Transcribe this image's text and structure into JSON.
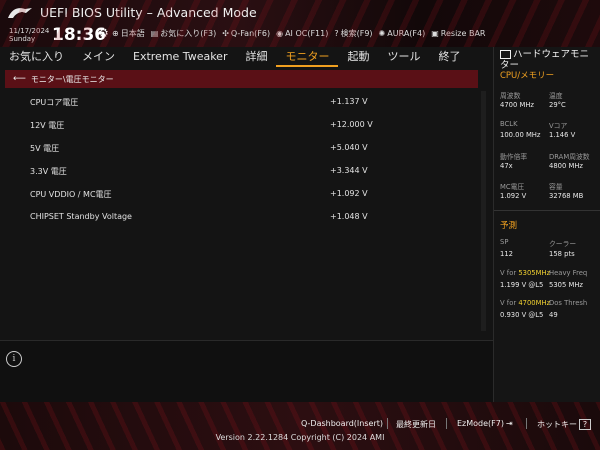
{
  "header": {
    "title": "UEFI BIOS Utility – Advanced Mode",
    "date": "11/17/2024",
    "day": "Sunday",
    "time": "18:36",
    "tools": [
      {
        "icon": "globe-icon",
        "label": "日本語"
      },
      {
        "icon": "star-icon",
        "label": "お気に入り(F3)"
      },
      {
        "icon": "fan-icon",
        "label": "Q-Fan(F6)"
      },
      {
        "icon": "ai-icon",
        "label": "AI OC(F11)"
      },
      {
        "icon": "help-icon",
        "label": "検索(F9)"
      },
      {
        "icon": "aura-icon",
        "label": "AURA(F4)"
      },
      {
        "icon": "resize-bar-icon",
        "label": "Resize BAR"
      }
    ]
  },
  "tabs": [
    "お気に入り",
    "メイン",
    "Extreme Tweaker",
    "詳細",
    "モニター",
    "起動",
    "ツール",
    "終了"
  ],
  "active_tab": "モニター",
  "breadcrumb": "モニター\\電圧モニター",
  "rows": [
    {
      "label": "CPUコア電圧",
      "value": "+1.137 V"
    },
    {
      "label": "12V 電圧",
      "value": "+12.000 V"
    },
    {
      "label": "5V 電圧",
      "value": "+5.040 V"
    },
    {
      "label": "3.3V 電圧",
      "value": "+3.344 V"
    },
    {
      "label": "CPU VDDIO / MC電圧",
      "value": "+1.092 V"
    },
    {
      "label": "CHIPSET Standby Voltage",
      "value": "+1.048 V"
    }
  ],
  "hw": {
    "title": "ハードウェアモニター",
    "cpu_section": "CPU/メモリー",
    "cpu": [
      {
        "label": "周波数",
        "value": "4700 MHz"
      },
      {
        "label": "温度",
        "value": "29°C"
      },
      {
        "label": "BCLK",
        "value": "100.00 MHz"
      },
      {
        "label": "Vコア",
        "value": "1.146 V"
      },
      {
        "label": "動作倍率",
        "value": "47x"
      },
      {
        "label": "DRAM周波数",
        "value": "4800 MHz"
      },
      {
        "label": "MC電圧",
        "value": "1.092 V"
      },
      {
        "label": "容量",
        "value": "32768 MB"
      }
    ],
    "pred_section": "予測",
    "sp_label": "SP",
    "sp_value": "112",
    "cooler_label": "クーラー",
    "cooler_value": "158 pts",
    "vfor1_prefix": "V for ",
    "vfor1_freq": "5305MHz",
    "heavy_label": "Heavy Freq",
    "vfor1_value": "1.199 V @L5",
    "heavy_value": "5305 MHz",
    "vfor2_prefix": "V for ",
    "vfor2_freq": "4700MHz",
    "dos_label": "Dos Thresh",
    "vfor2_value": "0.930 V @L5",
    "dos_value": "49"
  },
  "footer": {
    "qdash": "Q-Dashboard(Insert)",
    "last_mod": "最終更新日",
    "ezmode": "EzMode(F7)",
    "hotkeys": "ホットキー",
    "hotkeys_key": "?",
    "version": "Version 2.22.1284 Copyright (C) 2024 AMI"
  },
  "colors": {
    "accent": "#f0a020",
    "breadcrumb_bg": "#5a1016",
    "highlight": "#f0d030"
  }
}
